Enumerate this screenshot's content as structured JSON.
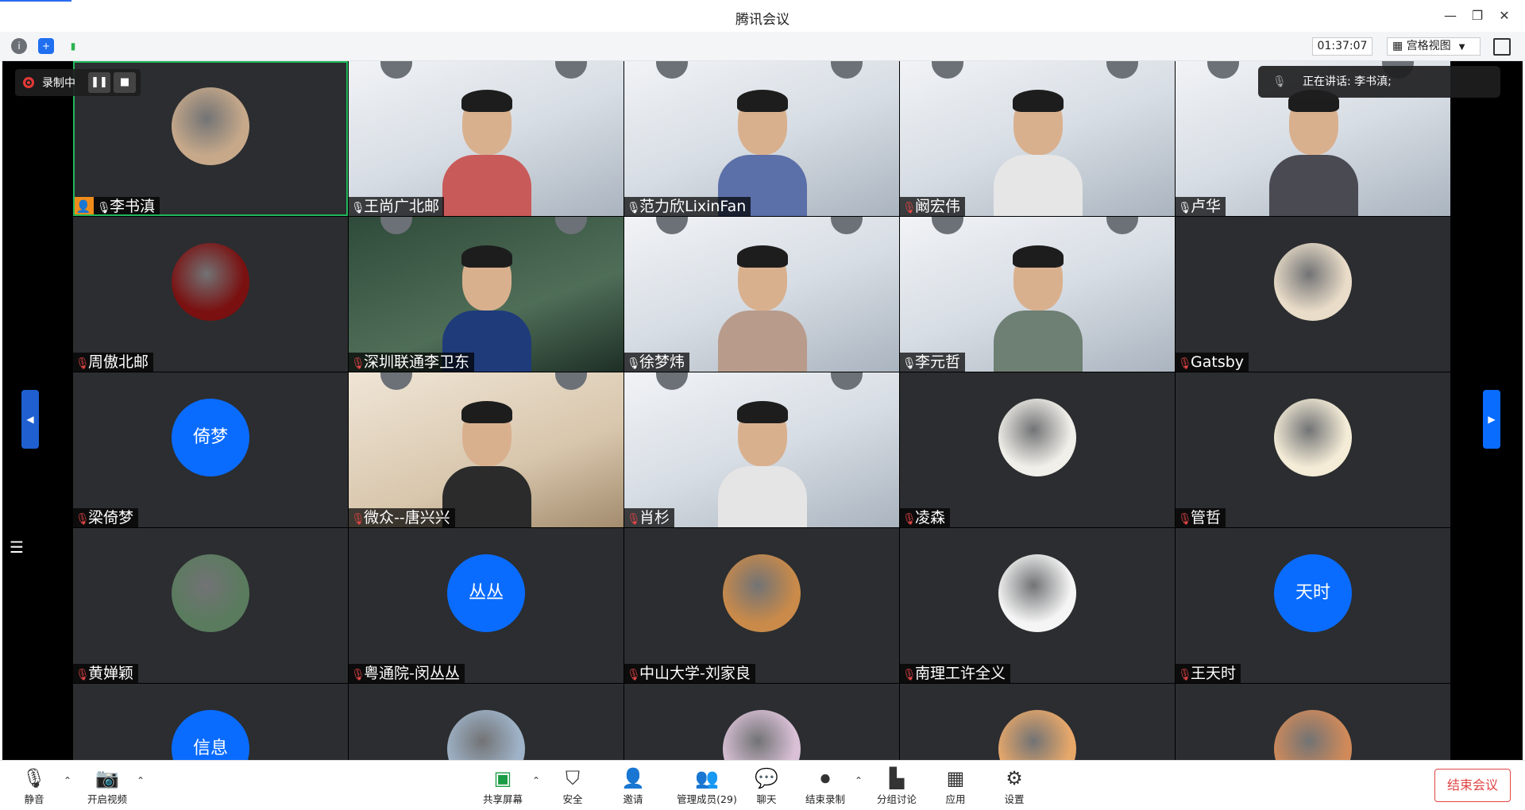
{
  "window": {
    "title": "腾讯会议"
  },
  "toolbar": {
    "timer": "01:37:07",
    "view_label": "宫格视图"
  },
  "recording": {
    "label": "录制中"
  },
  "speaking": {
    "label": "正在讲话: 李书滇;"
  },
  "tiles": [
    {
      "name": "李书滇",
      "muted": false,
      "kind": "photo-avatar",
      "host": true,
      "speaking": true
    },
    {
      "name": "王尚广北邮",
      "muted": false,
      "kind": "video"
    },
    {
      "name": "范力欣LixinFan",
      "muted": false,
      "kind": "video"
    },
    {
      "name": "阚宏伟",
      "muted": true,
      "kind": "video"
    },
    {
      "name": "卢华",
      "muted": false,
      "kind": "video"
    },
    {
      "name": "周傲北邮",
      "muted": true,
      "kind": "photo-avatar"
    },
    {
      "name": "深圳联通李卫东",
      "muted": true,
      "kind": "video"
    },
    {
      "name": "徐梦炜",
      "muted": false,
      "kind": "video"
    },
    {
      "name": "李元哲",
      "muted": false,
      "kind": "video"
    },
    {
      "name": "Gatsby",
      "muted": true,
      "kind": "photo-avatar"
    },
    {
      "name": "梁倚梦",
      "muted": true,
      "kind": "text-avatar",
      "avatar_text": "倚梦"
    },
    {
      "name": "微众--唐兴兴",
      "muted": true,
      "kind": "video"
    },
    {
      "name": "肖杉",
      "muted": true,
      "kind": "video"
    },
    {
      "name": "凌森",
      "muted": true,
      "kind": "photo-avatar"
    },
    {
      "name": "管哲",
      "muted": true,
      "kind": "photo-avatar"
    },
    {
      "name": "黄婵颖",
      "muted": true,
      "kind": "photo-avatar"
    },
    {
      "name": "粤通院-闵丛丛",
      "muted": true,
      "kind": "text-avatar",
      "avatar_text": "丛丛"
    },
    {
      "name": "中山大学-刘家良",
      "muted": true,
      "kind": "photo-avatar"
    },
    {
      "name": "南理工许全义",
      "muted": true,
      "kind": "photo-avatar"
    },
    {
      "name": "王天时",
      "muted": true,
      "kind": "text-avatar",
      "avatar_text": "天时"
    },
    {
      "name": "",
      "kind": "text-avatar",
      "avatar_text": "信息"
    },
    {
      "name": "",
      "kind": "photo-avatar"
    },
    {
      "name": "",
      "kind": "photo-avatar"
    },
    {
      "name": "",
      "kind": "photo-avatar"
    },
    {
      "name": "",
      "kind": "photo-avatar"
    }
  ],
  "bottom": {
    "mute": "静音",
    "video": "开启视频",
    "share": "共享屏幕",
    "security": "安全",
    "invite": "邀请",
    "members": "管理成员(29)",
    "chat": "聊天",
    "stop_record": "结束录制",
    "breakout": "分组讨论",
    "apps": "应用",
    "settings": "设置",
    "end": "结束会议"
  },
  "colors": {
    "accent": "#0a6cff",
    "danger": "#e04545",
    "speaking": "#20b85a"
  }
}
